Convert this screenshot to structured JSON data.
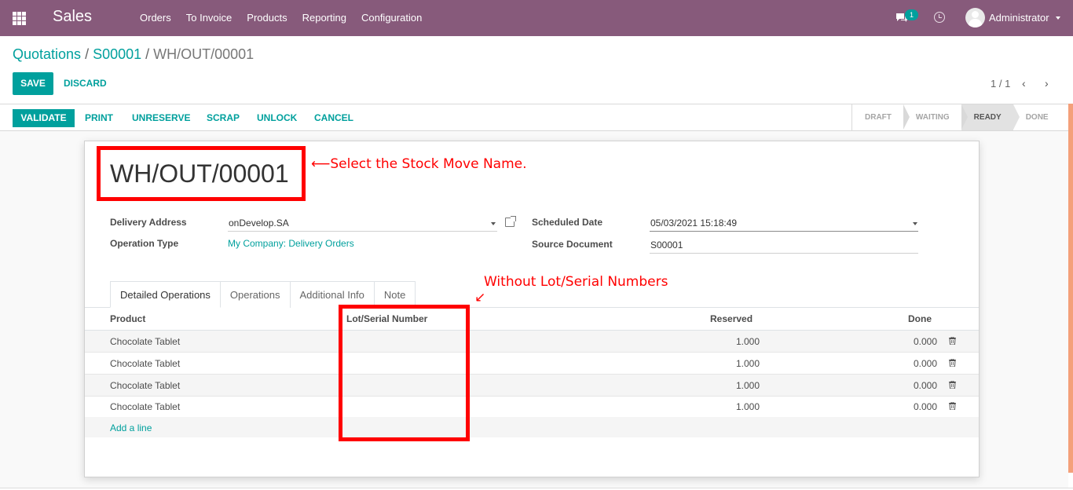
{
  "navbar": {
    "app_name": "Sales",
    "menu": [
      "Orders",
      "To Invoice",
      "Products",
      "Reporting",
      "Configuration"
    ],
    "chat_count": "1",
    "user": "Administrator",
    "color": "#875a7b"
  },
  "breadcrumb": {
    "items": [
      "Quotations",
      "S00001"
    ],
    "current": "WH/OUT/00001",
    "separator": "/"
  },
  "buttons": {
    "save": "SAVE",
    "discard": "DISCARD"
  },
  "pager": {
    "value": "1 / 1",
    "prev": "‹",
    "next": "›"
  },
  "statusbar": {
    "validate": "VALIDATE",
    "actions": [
      "PRINT",
      "UNRESERVE",
      "SCRAP",
      "UNLOCK",
      "CANCEL"
    ],
    "stages": [
      "DRAFT",
      "WAITING",
      "READY",
      "DONE"
    ],
    "active_stage": "READY"
  },
  "record": {
    "name": "WH/OUT/00001",
    "delivery_address_label": "Delivery Address",
    "delivery_address": "onDevelop.SA",
    "operation_type_label": "Operation Type",
    "operation_type": "My Company: Delivery Orders",
    "scheduled_date_label": "Scheduled Date",
    "scheduled_date": "05/03/2021 15:18:49",
    "source_document_label": "Source Document",
    "source_document": "S00001"
  },
  "tabs": [
    "Detailed Operations",
    "Operations",
    "Additional Info",
    "Note"
  ],
  "table": {
    "headers": {
      "product": "Product",
      "lot": "Lot/Serial Number",
      "reserved": "Reserved",
      "done": "Done"
    },
    "rows": [
      {
        "product": "Chocolate Tablet",
        "lot": "",
        "reserved": "1.000",
        "done": "0.000"
      },
      {
        "product": "Chocolate Tablet",
        "lot": "",
        "reserved": "1.000",
        "done": "0.000"
      },
      {
        "product": "Chocolate Tablet",
        "lot": "",
        "reserved": "1.000",
        "done": "0.000"
      },
      {
        "product": "Chocolate Tablet",
        "lot": "",
        "reserved": "1.000",
        "done": "0.000"
      }
    ],
    "add_line": "Add a line"
  },
  "annotations": {
    "name_note": "Select the Stock Move Name.",
    "lot_note": "Without Lot/Serial Numbers",
    "arrow_left": "⟵",
    "arrow_down": "↙",
    "color": "#ff0000"
  },
  "accent": "#00a09d"
}
